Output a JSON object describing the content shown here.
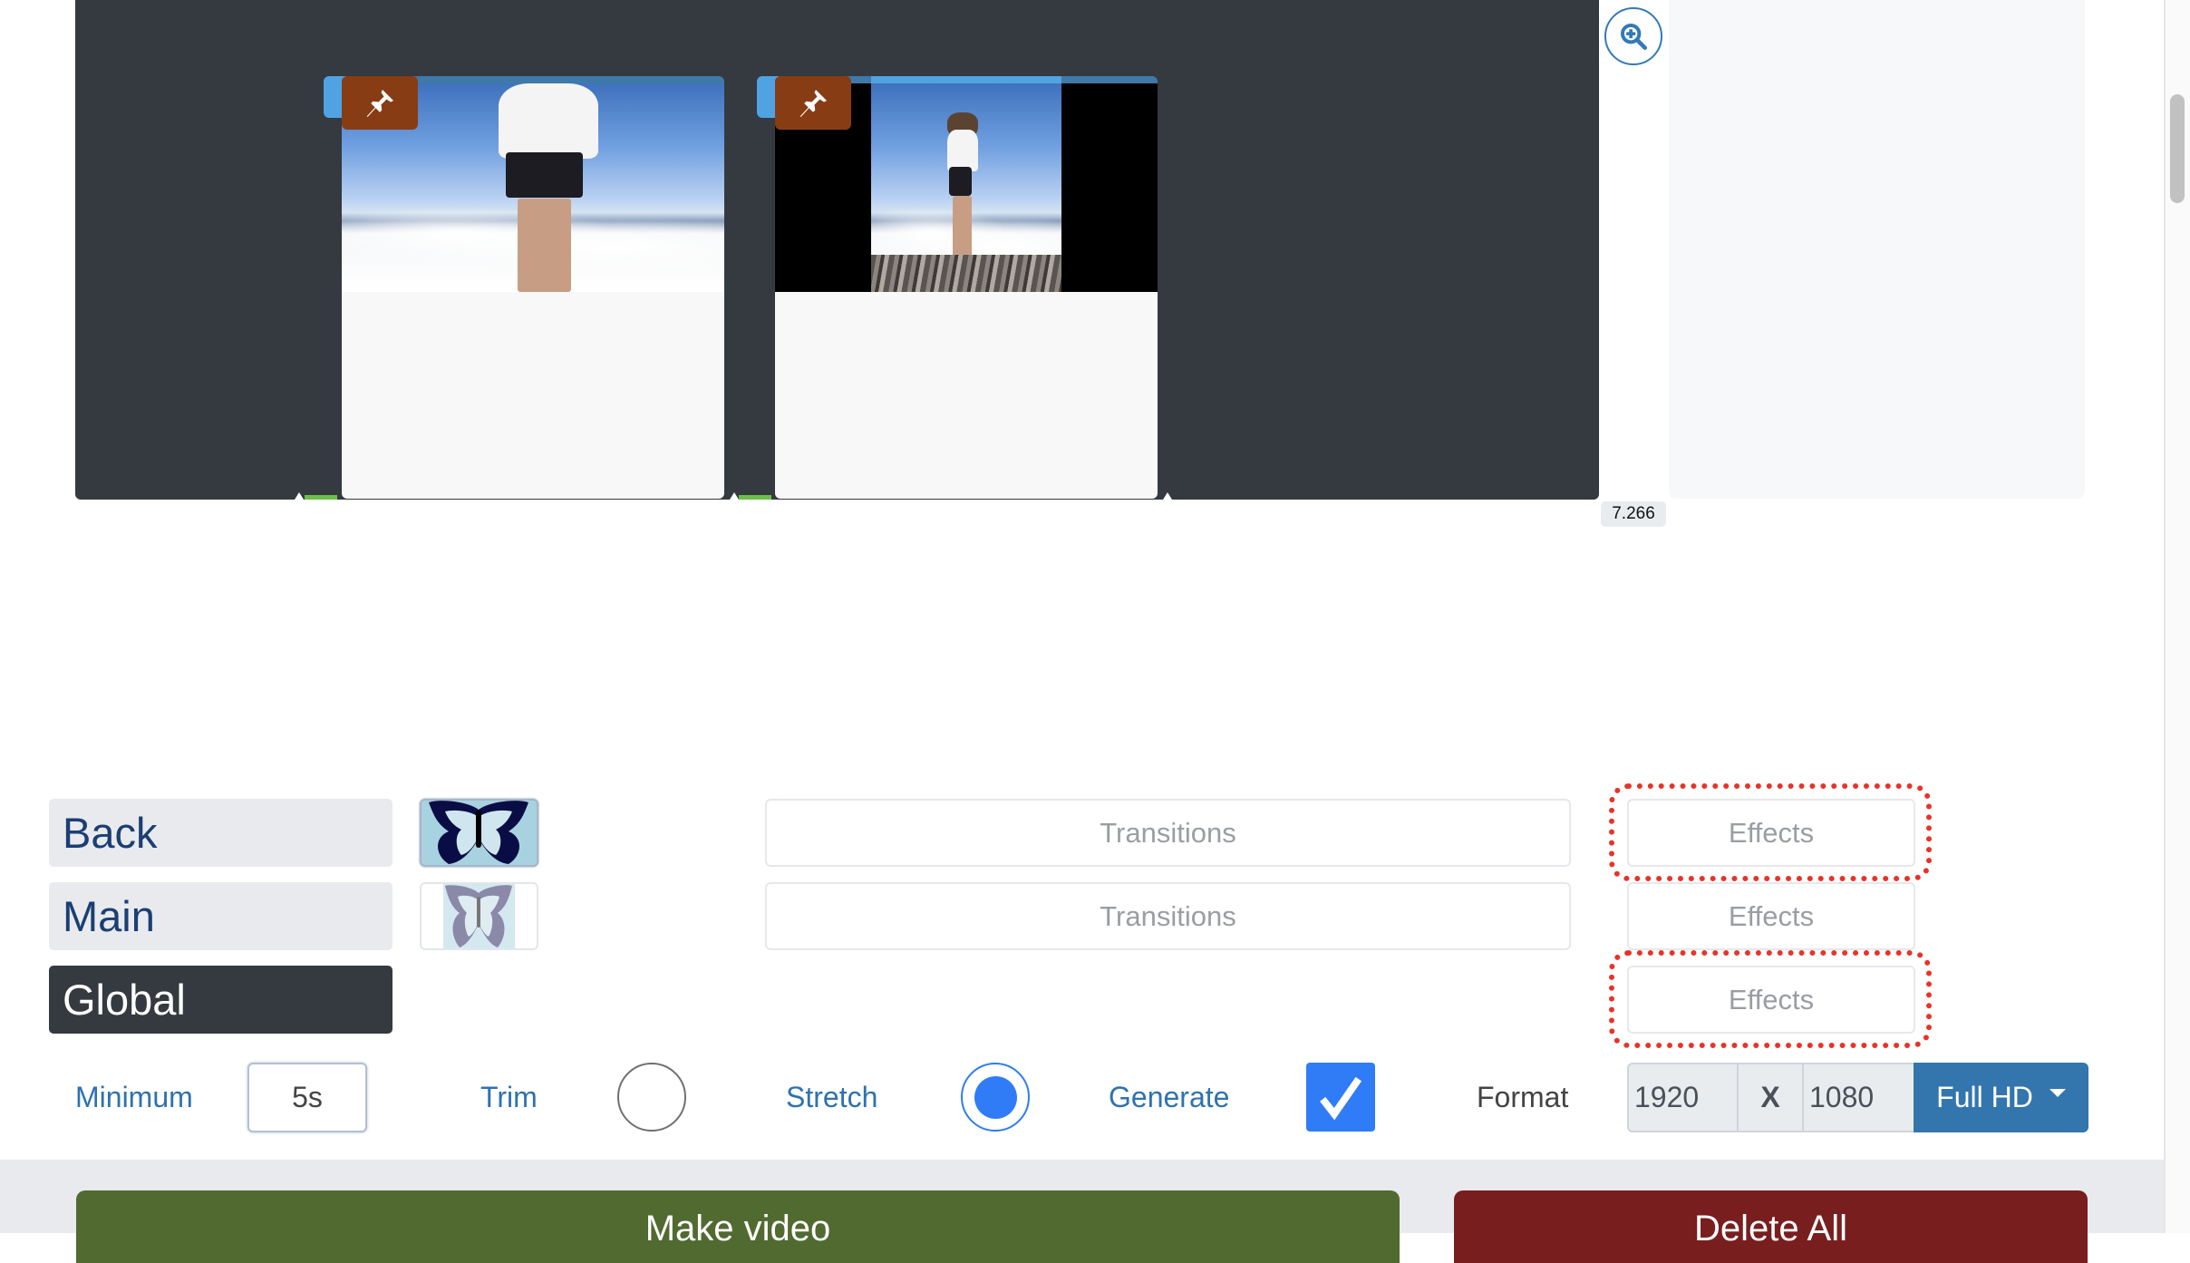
{
  "timeline": {
    "zoom_icon": "zoom-in-icon",
    "time_marker": "7.266",
    "clips": [
      {
        "pin_icon": "pushpin-icon",
        "pinned": true,
        "thumbnail": "woman-standing-above-clouds"
      },
      {
        "pin_icon": "pushpin-icon",
        "pinned": true,
        "thumbnail": "woman-on-mountain-peak-letterboxed"
      }
    ]
  },
  "layers": [
    {
      "label": "Back",
      "selected": false,
      "thumbnail": "butterfly-dark",
      "transitions_label": "Transitions",
      "effects_label": "Effects",
      "effects_highlighted": true
    },
    {
      "label": "Main",
      "selected": false,
      "thumbnail": "butterfly-faded",
      "transitions_label": "Transitions",
      "effects_label": "Effects",
      "effects_highlighted": false
    },
    {
      "label": "Global",
      "selected": true,
      "effects_label": "Effects",
      "effects_highlighted": true
    }
  ],
  "controls": {
    "minimum_label": "Minimum",
    "minimum_value": "5s",
    "trim_label": "Trim",
    "trim_selected": false,
    "stretch_label": "Stretch",
    "stretch_selected": true,
    "generate_label": "Generate",
    "generate_checked": true,
    "format_label": "Format",
    "format_width": "1920",
    "format_separator": "X",
    "format_height": "1080",
    "format_preset": "Full HD"
  },
  "footer": {
    "make_video_label": "Make video",
    "delete_all_label": "Delete All"
  },
  "colors": {
    "highlight_outline": "#e83328",
    "primary": "#3376ad",
    "make_video": "#516a30",
    "delete_all": "#781e1e",
    "pin": "#873c14"
  }
}
